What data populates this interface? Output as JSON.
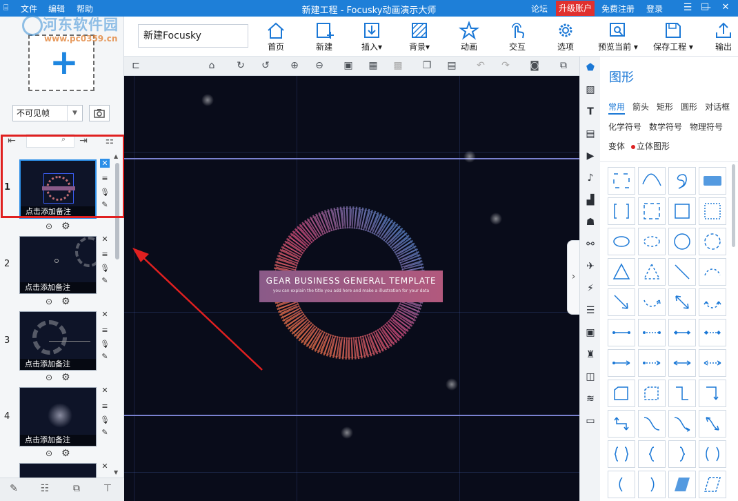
{
  "titlebar": {
    "menus": [
      "文件",
      "编辑",
      "帮助"
    ],
    "title": "新建工程 - Focusky动画演示大师",
    "links": {
      "forum": "论坛",
      "upgrade": "升级账户",
      "register": "免费注册",
      "login": "登录"
    },
    "window_buttons": {
      "menu": "☰",
      "minimize": "—",
      "maximize": "□",
      "close": "✕"
    }
  },
  "watermark": {
    "name": "河东软件园",
    "url": "www.pc0359.cn"
  },
  "toolbar": {
    "project_name": "新建Focusky",
    "buttons": [
      {
        "label": "首页",
        "icon": "home-icon"
      },
      {
        "label": "新建",
        "icon": "new-icon"
      },
      {
        "label": "插入",
        "icon": "insert-icon",
        "dropdown": true
      },
      {
        "label": "背景",
        "icon": "background-icon",
        "dropdown": true
      },
      {
        "label": "动画",
        "icon": "animation-icon"
      },
      {
        "label": "交互",
        "icon": "interaction-icon"
      },
      {
        "label": "选项",
        "icon": "gear-icon"
      },
      {
        "label": "预览当前",
        "icon": "preview-icon",
        "dropdown": true
      },
      {
        "label": "保存工程",
        "icon": "save-icon",
        "dropdown": true
      },
      {
        "label": "输出",
        "icon": "output-icon"
      }
    ]
  },
  "left_panel": {
    "visibility_select": "不可见帧",
    "slides": [
      {
        "number": "1",
        "note": "点击添加备注"
      },
      {
        "number": "2",
        "note": "点击添加备注"
      },
      {
        "number": "3",
        "note": "点击添加备注"
      },
      {
        "number": "4",
        "note": "点击添加备注"
      }
    ]
  },
  "canvas": {
    "banner_title": "GEAR BUSINESS GENERAL TEMPLATE",
    "banner_subtitle": "you can explain the title you add here and make a illustration for your data"
  },
  "shapes_panel": {
    "title": "图形",
    "categories": [
      "常用",
      "箭头",
      "矩形",
      "圆形",
      "对话框",
      "化学符号",
      "数学符号",
      "物理符号",
      "变体",
      "立体图形"
    ],
    "active_category": "常用"
  },
  "colors": {
    "accent": "#1e7fd8",
    "highlight": "#e02020",
    "canvas_bg": "#090c1a",
    "upgrade": "#e0302e"
  }
}
